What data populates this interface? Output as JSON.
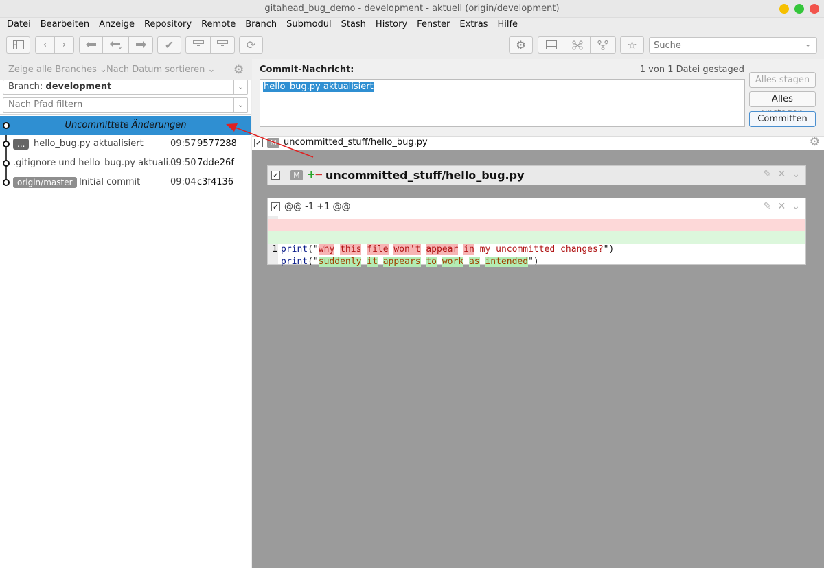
{
  "window": {
    "title": "gitahead_bug_demo - development - aktuell (origin/development)"
  },
  "menu": [
    "Datei",
    "Bearbeiten",
    "Anzeige",
    "Repository",
    "Remote",
    "Branch",
    "Submodul",
    "Stash",
    "History",
    "Fenster",
    "Extras",
    "Hilfe"
  ],
  "toolbar": {
    "search_placeholder": "Suche"
  },
  "sidebar": {
    "show_branches": "Zeige alle Branches",
    "sort_by": "Nach Datum sortieren",
    "branch_label": "Branch:",
    "branch_value": "development",
    "path_filter_placeholder": "Nach Pfad filtern"
  },
  "commits": [
    {
      "title": "Uncommittete Änderungen"
    },
    {
      "badge": "...",
      "message": "hello_bug.py aktualisiert",
      "time": "09:57",
      "hash": "9577288"
    },
    {
      "message": ".gitignore und hello_bug.py aktuali...",
      "time": "09:50",
      "hash": "7dde26f"
    },
    {
      "badge": "origin/master",
      "message": "Initial commit",
      "time": "09:04",
      "hash": "c3f4136"
    }
  ],
  "commit_panel": {
    "label": "Commit-Nachricht:",
    "staged_info": "1 von 1 Datei gestaged",
    "message": "hello_bug.py aktualisiert",
    "stage_all": "Alles stagen",
    "unstage_all": "Alles unstagen",
    "commit": "Committen"
  },
  "files": [
    {
      "status": "M",
      "path": "uncommitted_stuff/hello_bug.py",
      "checked": "✓"
    }
  ],
  "diff": {
    "status": "M",
    "file": "uncommitted_stuff/hello_bug.py",
    "hunk_header": "@@ -1 +1 @@",
    "lines": [
      {
        "type": "del",
        "num": "1",
        "fn": "print",
        "open": "(\"",
        "words": [
          "why",
          "this",
          "file",
          "won't",
          "appear",
          "in",
          "my",
          "uncommitted changes?"
        ],
        "close": "\")"
      },
      {
        "type": "add",
        "num": "1",
        "fn": "print",
        "open": "(\"",
        "words": [
          "suddenly",
          "it",
          "appears",
          "to",
          "work",
          "as",
          "intended"
        ],
        "close": "\")"
      }
    ]
  },
  "colors": {
    "selection": "#2f8fd2",
    "annotation_arrow": "#e02020",
    "diff_removed_bg": "#fdd8d8",
    "diff_added_bg": "#dcf7dc"
  }
}
